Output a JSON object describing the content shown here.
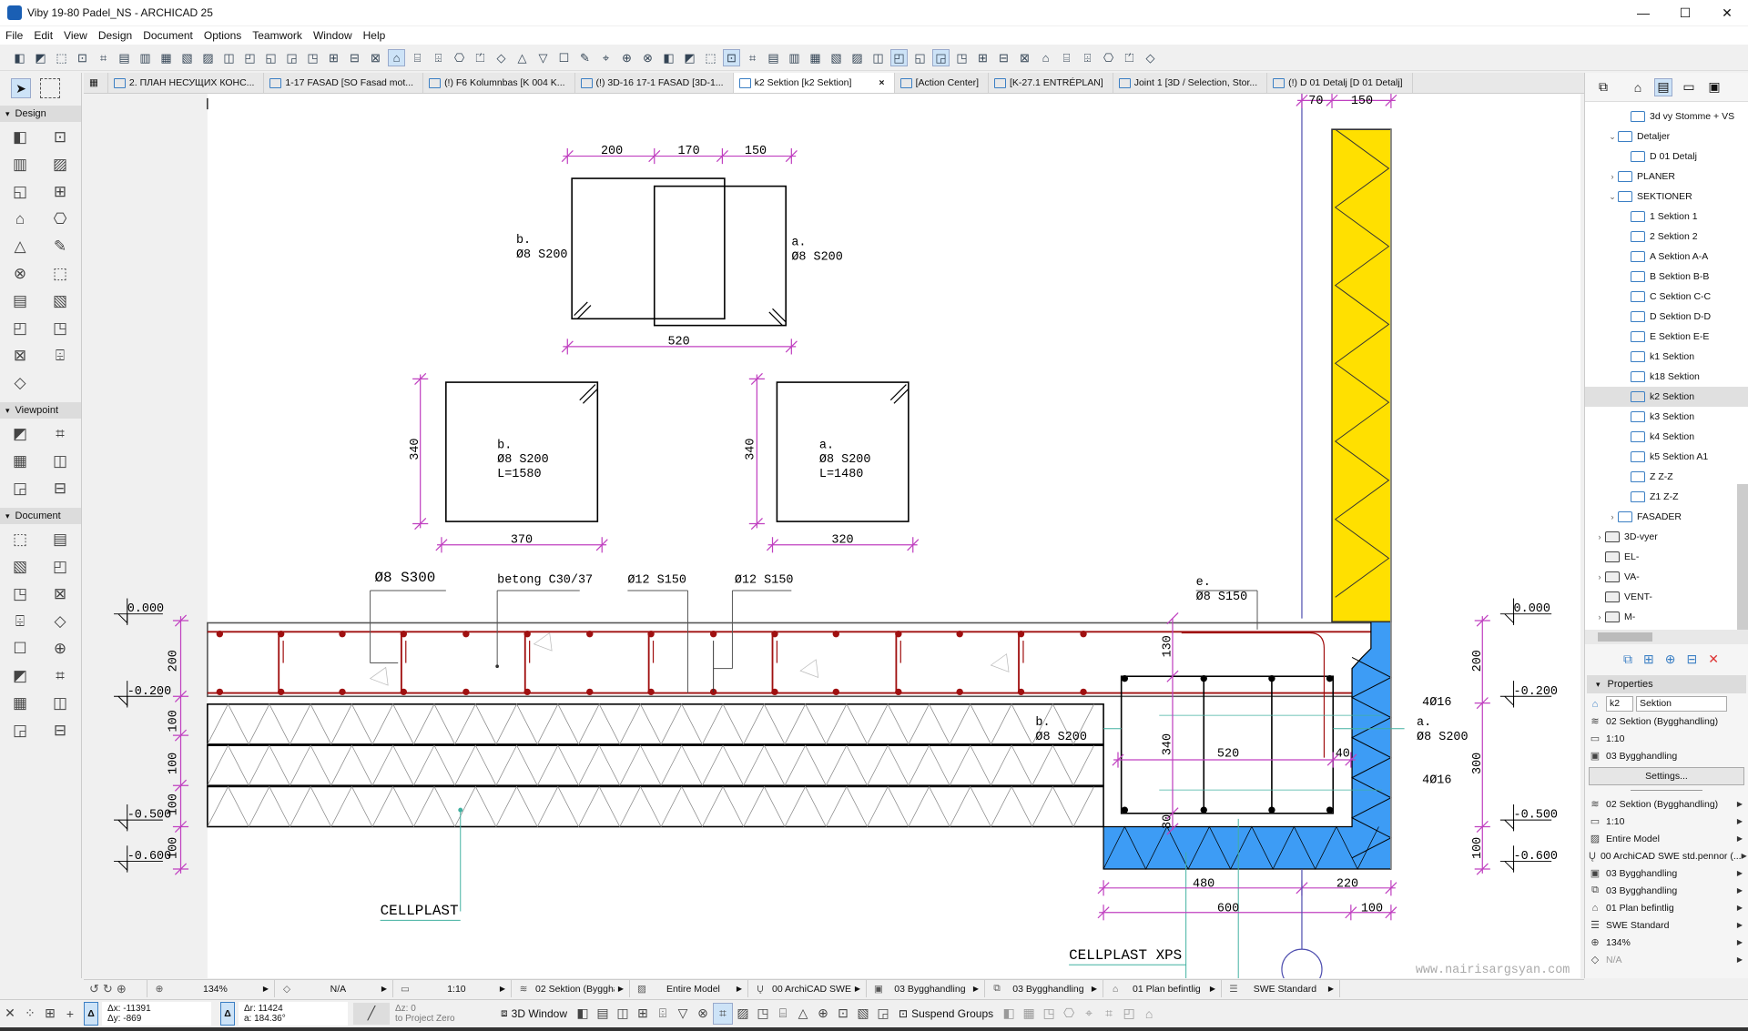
{
  "window": {
    "title": "Viby 19-80 Padel_NS - ARCHICAD 25",
    "minimize": "—",
    "maximize": "☐",
    "close": "✕"
  },
  "menu": [
    "File",
    "Edit",
    "View",
    "Design",
    "Document",
    "Options",
    "Teamwork",
    "Window",
    "Help"
  ],
  "toolbar_icons": [
    "undo",
    "redo",
    "eyedropper",
    "syringe",
    "magic-wand",
    "guide-line",
    "snap-guide",
    "grid",
    "grid-snap",
    "layers",
    "group",
    "lock",
    "suspend-groups",
    "arrange",
    "trim",
    "split",
    "adjust",
    "intersect",
    "fillet",
    "offset",
    "drag",
    "rotate",
    "mirror",
    "elevate",
    "resize",
    "label",
    "dimension",
    "renovation",
    "filter",
    "trace",
    "3d-cut",
    "section-marker",
    "detail-marker",
    "worksheet",
    "interior-elevation",
    "stair",
    "railing",
    "curtain-wall",
    "morph",
    "object",
    "lamp",
    "zone",
    "mesh",
    "fill",
    "line",
    "arc",
    "hotspot",
    "figure",
    "camera",
    "gravity",
    "magnet",
    "pet-palette",
    "select",
    "marquee",
    "eraser"
  ],
  "toolbar_active": [
    18,
    34,
    42,
    44
  ],
  "tabs": [
    {
      "label": "2. ПЛАН НЕСУЩИХ КОНС...",
      "active": false
    },
    {
      "label": "1-17 FASAD [SO Fasad mot...",
      "active": false
    },
    {
      "label": "(!) F6 Kolumnbas [K 004 K...",
      "active": false
    },
    {
      "label": "(!) 3D-16 17-1 FASAD [3D-1...",
      "active": false
    },
    {
      "label": "k2 Sektion [k2 Sektion]",
      "active": true,
      "close": "×"
    },
    {
      "label": "[Action Center]",
      "active": false
    },
    {
      "label": "[K-27.1 ENTRÉPLAN]",
      "active": false
    },
    {
      "label": "Joint 1 [3D / Selection, Stor...",
      "active": false
    },
    {
      "label": "(!) D 01 Detalj [D 01 Detalj]",
      "active": false
    }
  ],
  "toolbox": {
    "sections": [
      {
        "title": "Design",
        "icons": [
          "wall",
          "column",
          "beam",
          "slab",
          "roof",
          "shell",
          "skylight",
          "curtain-wall",
          "stair",
          "railing",
          "door",
          "window",
          "object",
          "zone",
          "mesh",
          "lamp",
          "morph",
          "opening",
          "corner-window"
        ]
      },
      {
        "title": "Viewpoint",
        "icons": [
          "section",
          "elevation",
          "interior-elevation",
          "worksheet",
          "detail",
          "camera"
        ]
      },
      {
        "title": "Document",
        "icons": [
          "dimension",
          "radial-dimension",
          "level-dimension",
          "angle-dimension",
          "text",
          "label",
          "hotspot",
          "fill",
          "line",
          "circle",
          "polyline",
          "spline",
          "arc",
          "figure",
          "drawing",
          "change-marker"
        ]
      }
    ]
  },
  "navigator": {
    "tree": [
      {
        "label": "3d vy Stomme + VS",
        "indent": 3,
        "chev": "",
        "type": "view"
      },
      {
        "label": "Detaljer",
        "indent": 2,
        "chev": "v",
        "type": "view"
      },
      {
        "label": "D 01 Detalj",
        "indent": 3,
        "chev": "",
        "type": "view"
      },
      {
        "label": "PLANER",
        "indent": 2,
        "chev": ">",
        "type": "view"
      },
      {
        "label": "SEKTIONER",
        "indent": 2,
        "chev": "v",
        "type": "view"
      },
      {
        "label": "1 Sektion 1",
        "indent": 3,
        "chev": "",
        "type": "view"
      },
      {
        "label": "2 Sektion 2",
        "indent": 3,
        "chev": "",
        "type": "view"
      },
      {
        "label": "A Sektion A-A",
        "indent": 3,
        "chev": "",
        "type": "view"
      },
      {
        "label": "B Sektion B-B",
        "indent": 3,
        "chev": "",
        "type": "view"
      },
      {
        "label": "C Sektion C-C",
        "indent": 3,
        "chev": "",
        "type": "view"
      },
      {
        "label": "D Sektion D-D",
        "indent": 3,
        "chev": "",
        "type": "view"
      },
      {
        "label": "E Sektion E-E",
        "indent": 3,
        "chev": "",
        "type": "view"
      },
      {
        "label": "k1 Sektion",
        "indent": 3,
        "chev": "",
        "type": "view"
      },
      {
        "label": "k18 Sektion",
        "indent": 3,
        "chev": "",
        "type": "view"
      },
      {
        "label": "k2 Sektion",
        "indent": 3,
        "chev": "",
        "type": "view",
        "selected": true
      },
      {
        "label": "k3 Sektion",
        "indent": 3,
        "chev": "",
        "type": "view"
      },
      {
        "label": "k4 Sektion",
        "indent": 3,
        "chev": "",
        "type": "view"
      },
      {
        "label": "k5 Sektion A1",
        "indent": 3,
        "chev": "",
        "type": "view"
      },
      {
        "label": "Z Z-Z",
        "indent": 3,
        "chev": "",
        "type": "view"
      },
      {
        "label": "Z1 Z-Z",
        "indent": 3,
        "chev": "",
        "type": "view"
      },
      {
        "label": "FASADER",
        "indent": 2,
        "chev": ">",
        "type": "view"
      },
      {
        "label": "3D-vyer",
        "indent": 1,
        "chev": ">",
        "type": "folder"
      },
      {
        "label": "EL-",
        "indent": 1,
        "chev": "",
        "type": "folder"
      },
      {
        "label": "VA-",
        "indent": 1,
        "chev": ">",
        "type": "folder"
      },
      {
        "label": "VENT-",
        "indent": 1,
        "chev": "",
        "type": "folder"
      },
      {
        "label": "M-",
        "indent": 1,
        "chev": ">",
        "type": "folder"
      }
    ],
    "properties": {
      "title": "Properties",
      "id_value": "k2",
      "name_value": "Sektion",
      "rows_top": [
        {
          "icon": "≋",
          "label": "02 Sektion (Bygghandling)"
        },
        {
          "icon": "▭",
          "label": "1:10"
        },
        {
          "icon": "▣",
          "label": "03 Bygghandling"
        }
      ],
      "settings": "Settings...",
      "rows": [
        {
          "icon": "≋",
          "label": "02 Sektion (Bygghandling)"
        },
        {
          "icon": "▭",
          "label": "1:10"
        },
        {
          "icon": "▨",
          "label": "Entire Model"
        },
        {
          "icon": "Ų",
          "label": "00 ArchiCAD SWE std.pennor (..."
        },
        {
          "icon": "▣",
          "label": "03 Bygghandling"
        },
        {
          "icon": "⧉",
          "label": "03 Bygghandling"
        },
        {
          "icon": "⌂",
          "label": "01 Plan befintlig"
        },
        {
          "icon": "☰",
          "label": "SWE Standard"
        },
        {
          "icon": "⊕",
          "label": "134%"
        },
        {
          "icon": "◇",
          "label": "N/A",
          "dim": true
        }
      ]
    }
  },
  "status_bar": {
    "cells": [
      {
        "icon": "⊕",
        "value": "134%"
      },
      {
        "icon": "◇",
        "value": "N/A"
      },
      {
        "icon": "▭",
        "value": "1:10"
      },
      {
        "icon": "≋",
        "value": "02 Sektion (Bygghandli..."
      },
      {
        "icon": "▨",
        "value": "Entire Model"
      },
      {
        "icon": "Ų",
        "value": "00 ArchiCAD SWE std.p..."
      },
      {
        "icon": "▣",
        "value": "03 Bygghandling"
      },
      {
        "icon": "⧉",
        "value": "03 Bygghandling"
      },
      {
        "icon": "⌂",
        "value": "01 Plan befintlig"
      },
      {
        "icon": "☰",
        "value": "SWE Standard"
      }
    ]
  },
  "coords": {
    "dx": "Δx: -11391",
    "dy": "Δy: -869",
    "dr": "Δr: 11424",
    "a": "a: 184.36°",
    "dz": "Δz: 0",
    "dz_ref": "to Project Zero",
    "delta": "Δ"
  },
  "bottom_buttons": {
    "window3d": "3D Window",
    "suspend": "Suspend Groups"
  },
  "drawing": {
    "colors": {
      "dim": "#c040c0",
      "rebar": "#a01010",
      "insul_xps": "#3d9cf5",
      "wall": "#ffe000",
      "leader": "#40b0a0"
    },
    "top_dims": [
      "200",
      "170",
      "150"
    ],
    "top_bottom_dim": "520",
    "tie_b": [
      "b.",
      "Ø8 S200"
    ],
    "tie_a": [
      "a.",
      "Ø8 S200"
    ],
    "box_b": [
      "b.",
      "Ø8 S200",
      "L=1580"
    ],
    "box_b_h": "340",
    "box_b_w": "370",
    "box_a": [
      "a.",
      "Ø8 S200",
      "L=1480"
    ],
    "box_a_h": "340",
    "box_a_w": "320",
    "callouts": {
      "c1": "Ø8 S300",
      "c2": "betong C30/37",
      "c3": "Ø12 S150",
      "c4": "Ø12 S150",
      "e1": "e.",
      "e2": "Ø8 S150"
    },
    "levels": [
      "0.000",
      "-0.200",
      "-0.500",
      "-0.600"
    ],
    "left_dims": [
      "200",
      "100",
      "100",
      "100",
      "100"
    ],
    "right_dims": [
      "200",
      "300",
      "100"
    ],
    "beam": {
      "b1": "b.",
      "b2": "Ø8 S200",
      "a1": "a.",
      "a2": "Ø8 S200",
      "r1": "4Ø16",
      "r2": "4Ø16",
      "d130": "130",
      "d340": "340",
      "d30": "30",
      "d520": "520",
      "d40": "40"
    },
    "wall_dims": [
      "70",
      "150"
    ],
    "bottom_dims": [
      "480",
      "220",
      "600",
      "100"
    ],
    "cellplast": "CELLPLAST",
    "cellplast_xps": "CELLPLAST XPS",
    "watermark": "www.nairisargsyan.com"
  }
}
